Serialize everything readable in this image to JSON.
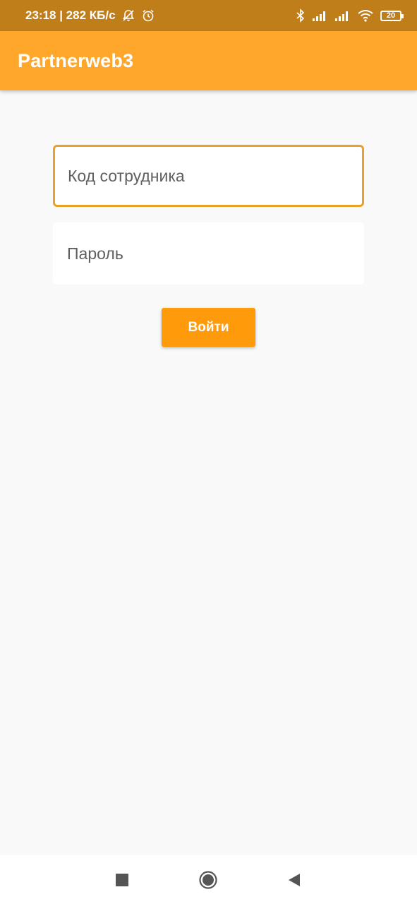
{
  "status_bar": {
    "time_and_speed": "23:18 | 282 КБ/с",
    "battery": "20",
    "icons": [
      "muted-bell-icon",
      "alarm-clock-icon",
      "bluetooth-icon",
      "signal-icon",
      "signal-icon",
      "wifi-icon",
      "battery-icon"
    ]
  },
  "app_bar": {
    "title": "Partnerweb3",
    "color": "#ffa72a"
  },
  "login_form": {
    "employee_code": {
      "placeholder": "Код сотрудника",
      "value": ""
    },
    "password": {
      "placeholder": "Пароль",
      "value": ""
    },
    "submit_label": "Войти",
    "accent_color": "#ff9a0a"
  },
  "nav_bar": {
    "icons": [
      "recents-square-icon",
      "home-circle-icon",
      "back-triangle-icon"
    ]
  }
}
